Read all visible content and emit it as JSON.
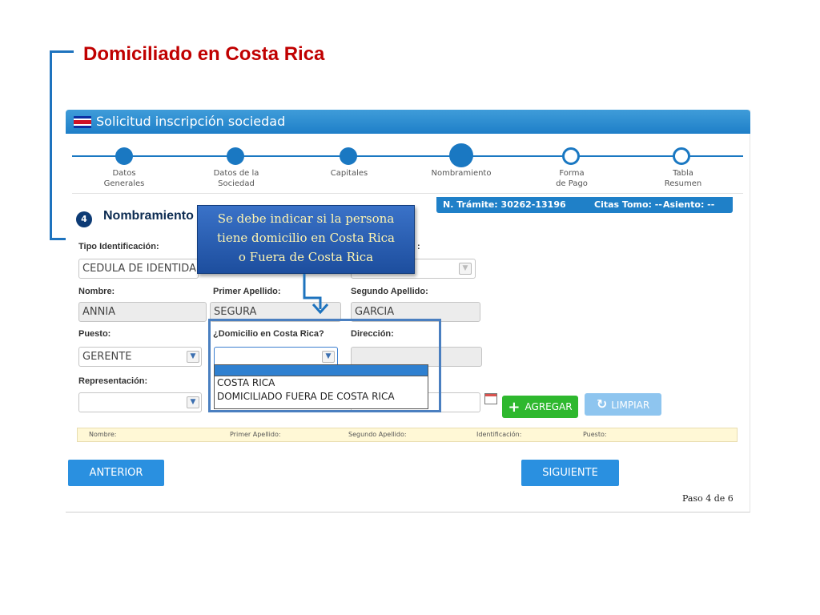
{
  "slide": {
    "title": "Domiciliado en Costa Rica"
  },
  "app": {
    "title": "Solicitud inscripción sociedad"
  },
  "steps": [
    {
      "label": "Datos\nGenerales"
    },
    {
      "label": "Datos de la\nSociedad"
    },
    {
      "label": "Capitales"
    },
    {
      "label": "Nombramiento"
    },
    {
      "label": "Forma\nde Pago"
    },
    {
      "label": "Tabla\nResumen"
    }
  ],
  "section": {
    "number": "4",
    "title": "Nombramiento"
  },
  "tramite": {
    "numero": "N. Trámite: 30262-13196",
    "citas": "Citas Tomo: --",
    "asiento": "Asiento: --"
  },
  "form": {
    "tipo_identificacion_label": "Tipo Identificación:",
    "tipo_identificacion_value": "CEDULA DE IDENTIDAD",
    "hidden_label_colon": ":",
    "nombre_label": "Nombre:",
    "nombre_value": "ANNIA",
    "primer_apellido_label": "Primer Apellido:",
    "primer_apellido_value": "SEGURA",
    "segundo_apellido_label": "Segundo Apellido:",
    "segundo_apellido_value": "GARCIA",
    "puesto_label": "Puesto:",
    "puesto_value": "GERENTE",
    "domicilio_label": "¿Domicilio en Costa Rica?",
    "domicilio_options": [
      "COSTA RICA",
      "DOMICILIADO FUERA DE COSTA RICA"
    ],
    "direccion_label": "Dirección:",
    "representacion_label": "Representación:"
  },
  "buttons": {
    "agregar": "AGREGAR",
    "limpiar": "LIMPIAR",
    "anterior": "ANTERIOR",
    "siguiente": "SIGUIENTE"
  },
  "list_columns": [
    "Nombre:",
    "Primer Apellido:",
    "Segundo Apellido:",
    "Identificación:",
    "Puesto:"
  ],
  "paso": "Paso 4 de 6",
  "tooltip": {
    "lines": [
      "Se debe indicar si la persona",
      "tiene domicilio en Costa Rica",
      "o Fuera de Costa Rica"
    ]
  },
  "colors": {
    "title": "#c00000",
    "accent": "#1a78c2",
    "tooltip_text": "#fff5b0",
    "agregar": "#2eb82e"
  }
}
